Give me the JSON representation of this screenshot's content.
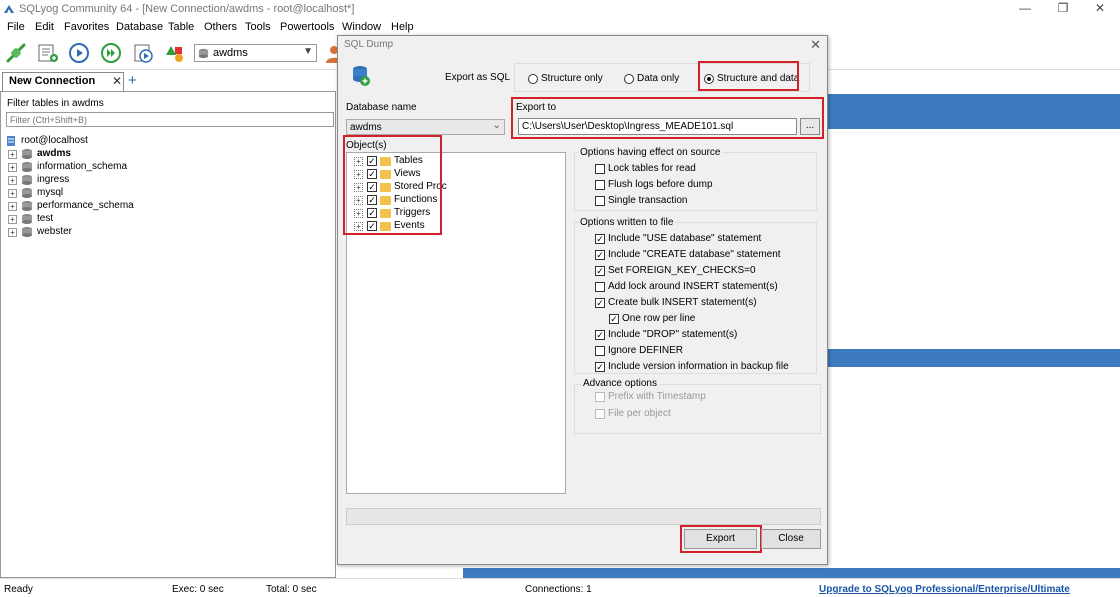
{
  "window": {
    "title": "SQLyog Community 64 - [New Connection/awdms - root@localhost*]",
    "minimize": "—",
    "maximize": "❐",
    "close": "✕"
  },
  "menu": [
    "File",
    "Edit",
    "Favorites",
    "Database",
    "Table",
    "Others",
    "Tools",
    "Powertools",
    "Window",
    "Help"
  ],
  "toolbar": {
    "database_select": "awdms"
  },
  "tabs": {
    "connection_tab": "New Connection",
    "close": "✕",
    "add": "+"
  },
  "left_panel": {
    "filter_label": "Filter tables in awdms",
    "filter_placeholder": "Filter (Ctrl+Shift+B)",
    "root": "root@localhost",
    "databases": [
      "awdms",
      "information_schema",
      "ingress",
      "mysql",
      "performance_schema",
      "test",
      "webster"
    ],
    "selected_database": "awdms"
  },
  "dialog": {
    "title": "SQL Dump",
    "close": "✕",
    "export_as_label": "Export as SQL",
    "export_options": [
      "Structure only",
      "Data only",
      "Structure and data"
    ],
    "export_selected": "Structure and data",
    "database_name_label": "Database name",
    "database_name_value": "awdms",
    "export_to_label": "Export to",
    "export_path": "C:\\Users\\User\\Desktop\\Ingress_MEADE101.sql",
    "browse": "...",
    "objects_label": "Object(s)",
    "objects": [
      {
        "name": "Tables",
        "checked": true
      },
      {
        "name": "Views",
        "checked": true
      },
      {
        "name": "Stored Proc",
        "checked": true
      },
      {
        "name": "Functions",
        "checked": true
      },
      {
        "name": "Triggers",
        "checked": true
      },
      {
        "name": "Events",
        "checked": true
      }
    ],
    "source_options_title": "Options having effect on source",
    "source_options": [
      {
        "label": "Lock tables for read",
        "checked": false
      },
      {
        "label": "Flush logs before dump",
        "checked": false
      },
      {
        "label": "Single transaction",
        "checked": false
      }
    ],
    "file_options_title": "Options written to file",
    "file_options": [
      {
        "label": "Include \"USE database\" statement",
        "checked": true
      },
      {
        "label": "Include \"CREATE database\" statement",
        "checked": true
      },
      {
        "label": "Set FOREIGN_KEY_CHECKS=0",
        "checked": true
      },
      {
        "label": "Add lock around INSERT statement(s)",
        "checked": false
      },
      {
        "label": "Create bulk INSERT statement(s)",
        "checked": true
      },
      {
        "label": "One row per line",
        "checked": true
      },
      {
        "label": "Include \"DROP\" statement(s)",
        "checked": true
      },
      {
        "label": "Ignore DEFINER",
        "checked": false
      },
      {
        "label": "Include version information in backup file",
        "checked": true
      }
    ],
    "advance_title": "Advance options",
    "advance_options": [
      {
        "label": "Prefix with Timestamp",
        "checked": false
      },
      {
        "label": "File per object",
        "checked": false
      }
    ],
    "export_button": "Export",
    "close_button": "Close"
  },
  "statusbar": {
    "status": "Ready",
    "exec": "Exec: 0 sec",
    "total": "Total: 0 sec",
    "connections": "Connections: 1",
    "upgrade_link": "Upgrade to SQLyog Professional/Enterprise/Ultimate"
  },
  "colors": {
    "highlight_box": "#d4202a",
    "blue_band": "#3c7bbf",
    "link": "#1a56a8"
  }
}
